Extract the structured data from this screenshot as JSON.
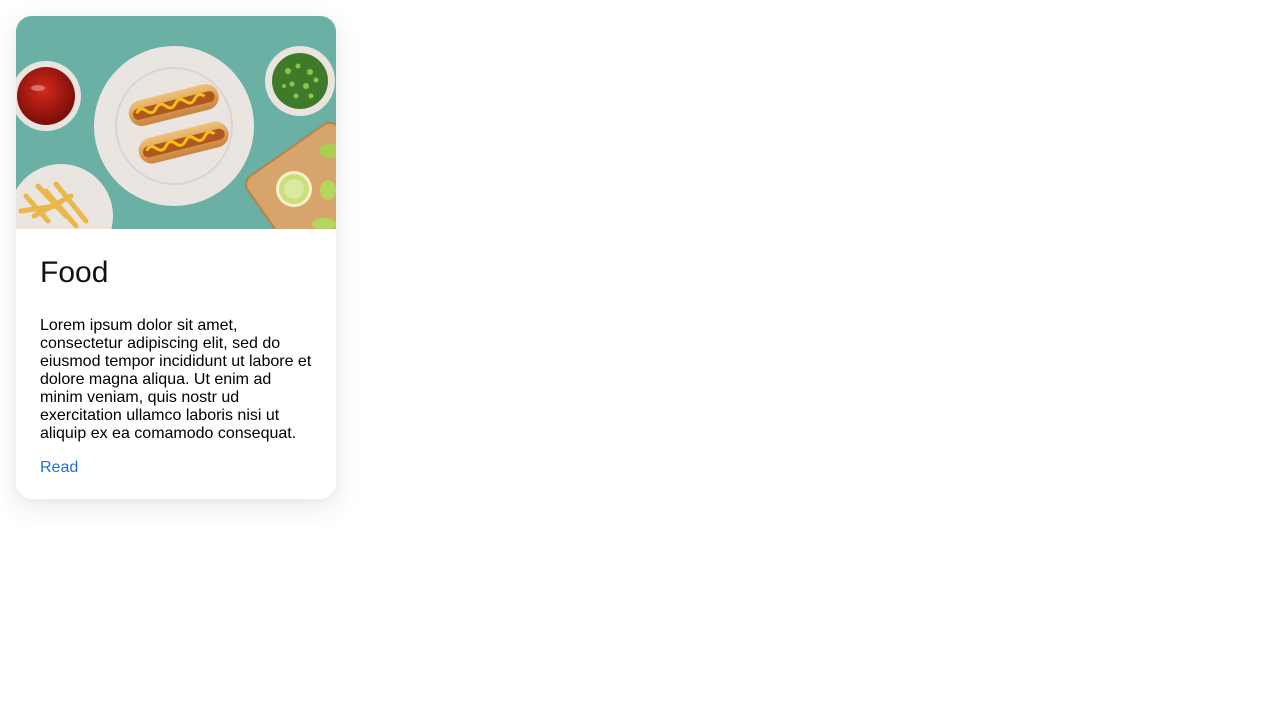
{
  "card": {
    "image_alt": "Hot dogs with mustard on a plate, ketchup, chopped herbs, fries and lime slices on a teal surface",
    "title": "Food",
    "description": "Lorem ipsum dolor sit amet, consectetur adipiscing elit, sed do eiusmod tempor incididunt ut labore et dolore magna aliqua. Ut enim ad minim veniam, quis nostr ud exercitation ullamco laboris nisi ut aliquip ex ea comamodo consequat.",
    "link_label": "Read"
  },
  "colors": {
    "link": "#1a73d9",
    "image_background": "#6db3a6"
  }
}
